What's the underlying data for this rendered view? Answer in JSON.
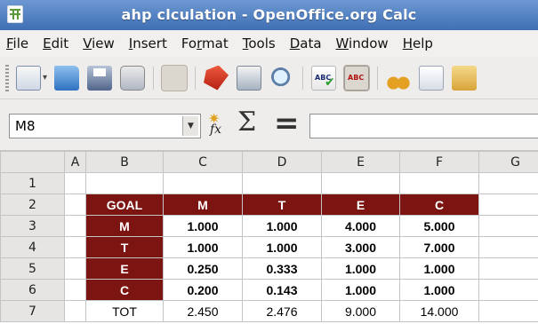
{
  "window": {
    "title": "ahp clculation - OpenOffice.org Calc"
  },
  "menu": [
    {
      "label": "File",
      "ul": "F",
      "rest": "ile"
    },
    {
      "label": "Edit",
      "ul": "E",
      "rest": "dit"
    },
    {
      "label": "View",
      "ul": "V",
      "rest": "iew"
    },
    {
      "label": "Insert",
      "ul": "I",
      "rest": "nsert"
    },
    {
      "label": "Format",
      "pre": "Fo",
      "ul": "r",
      "rest": "mat"
    },
    {
      "label": "Tools",
      "ul": "T",
      "rest": "ools"
    },
    {
      "label": "Data",
      "ul": "D",
      "rest": "ata"
    },
    {
      "label": "Window",
      "ul": "W",
      "rest": "indow"
    },
    {
      "label": "Help",
      "ul": "H",
      "rest": "elp"
    }
  ],
  "toolbar": {
    "spell_label": "ABC",
    "autospell_label": "ABC"
  },
  "formula_bar": {
    "cell_ref": "M8",
    "function_wizard_label": "fx",
    "sum_symbol": "Σ",
    "equals_symbol": "=",
    "input_value": ""
  },
  "sheet": {
    "columns": [
      "A",
      "B",
      "C",
      "D",
      "E",
      "F",
      "G"
    ],
    "rows": [
      {
        "num": "1",
        "a": "",
        "b": "",
        "c": "",
        "d": "",
        "e": "",
        "f": "",
        "g": ""
      },
      {
        "num": "2",
        "a": "",
        "b": "GOAL",
        "c": "M",
        "d": "T",
        "e": "E",
        "f": "C",
        "g": ""
      },
      {
        "num": "3",
        "a": "",
        "b": "M",
        "c": "1.000",
        "d": "1.000",
        "e": "4.000",
        "f": "5.000",
        "g": ""
      },
      {
        "num": "4",
        "a": "",
        "b": "T",
        "c": "1.000",
        "d": "1.000",
        "e": "3.000",
        "f": "7.000",
        "g": ""
      },
      {
        "num": "5",
        "a": "",
        "b": "E",
        "c": "0.250",
        "d": "0.333",
        "e": "1.000",
        "f": "1.000",
        "g": ""
      },
      {
        "num": "6",
        "a": "",
        "b": "C",
        "c": "0.200",
        "d": "0.143",
        "e": "1.000",
        "f": "1.000",
        "g": ""
      },
      {
        "num": "7",
        "a": "",
        "b": "TOT",
        "c": "2.450",
        "d": "2.476",
        "e": "9.000",
        "f": "14.000",
        "g": ""
      }
    ]
  },
  "colors": {
    "header_fill": "#7c1512",
    "title_bar": "#4f7fc2"
  }
}
